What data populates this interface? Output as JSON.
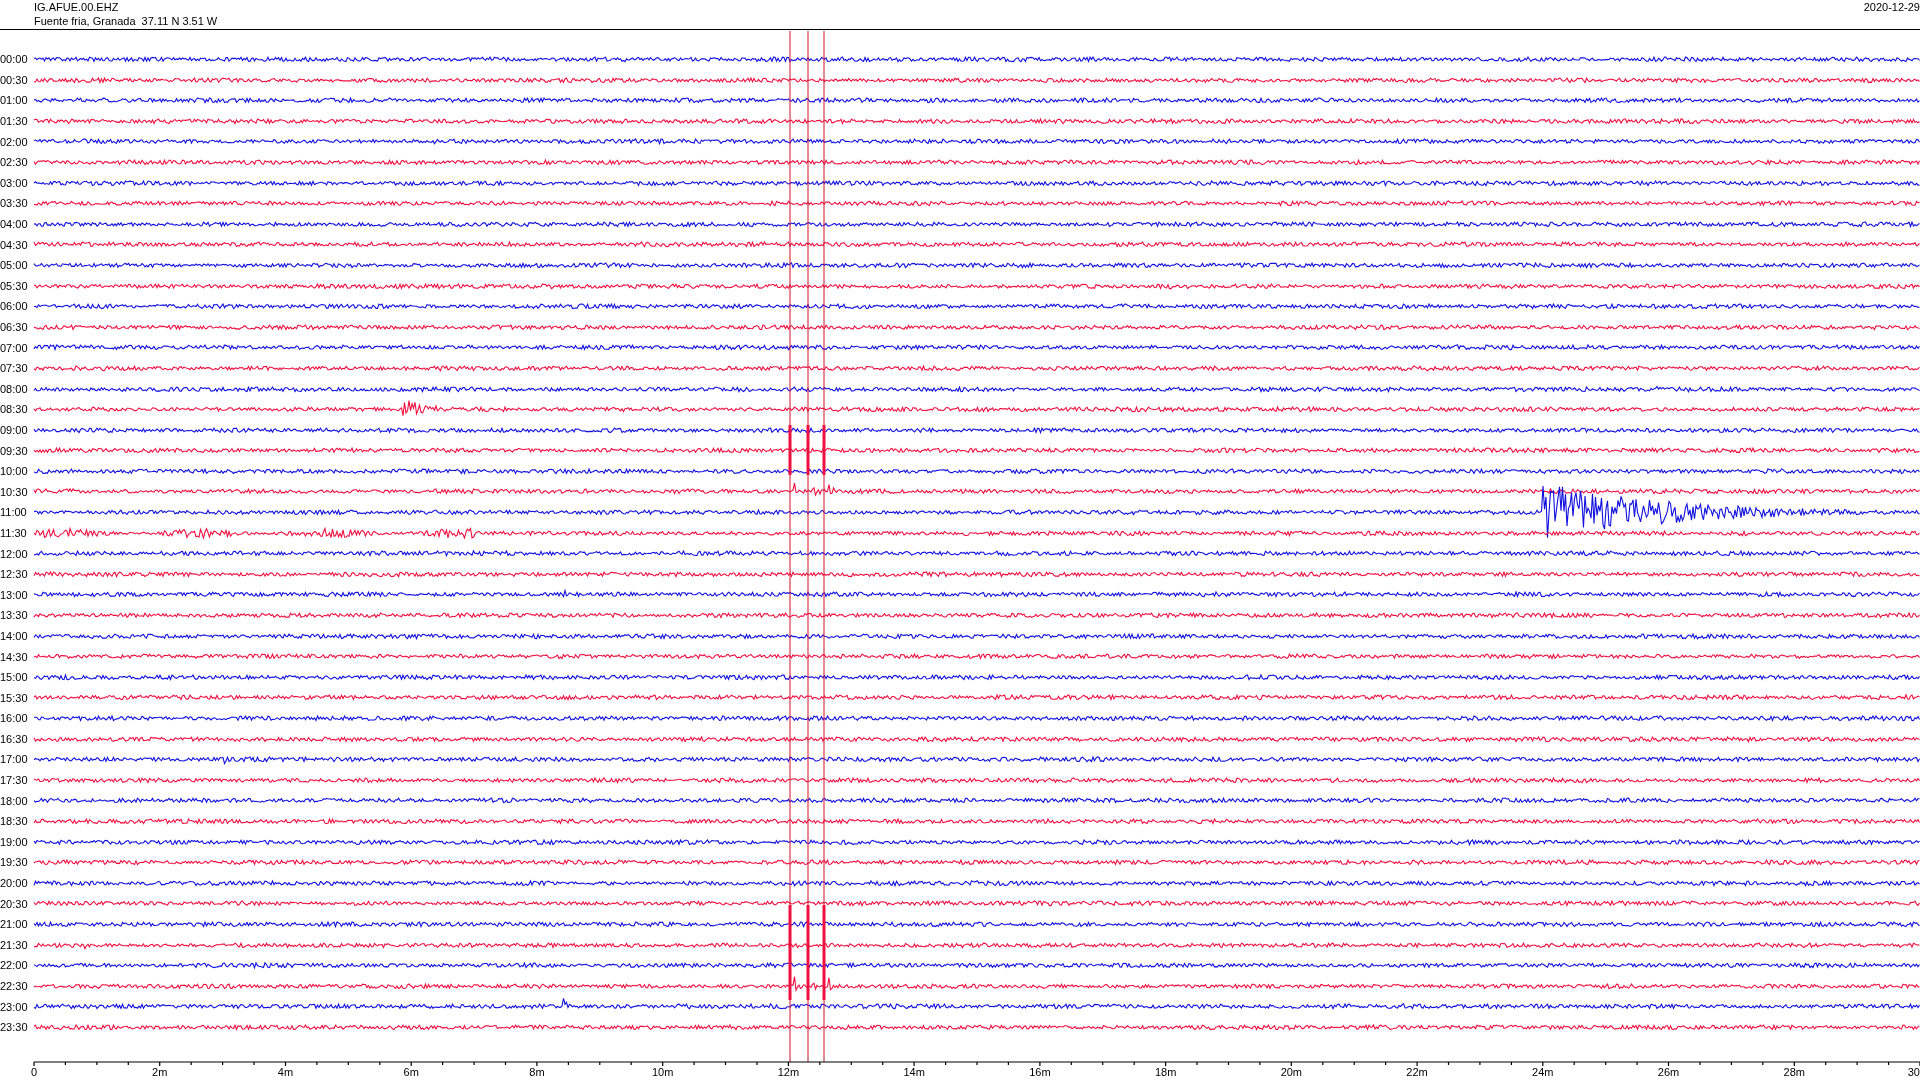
{
  "header": {
    "station": "IG.AFUE.00.EHZ",
    "location": "Fuente fria, Granada  37.11 N 3.51 W",
    "date": "2020-12-29"
  },
  "rows": [
    {
      "time": "00:00",
      "color": "#1010e0"
    },
    {
      "time": "00:30",
      "color": "#f01040"
    },
    {
      "time": "01:00",
      "color": "#1010e0"
    },
    {
      "time": "01:30",
      "color": "#f01040"
    },
    {
      "time": "02:00",
      "color": "#1010e0"
    },
    {
      "time": "02:30",
      "color": "#f01040"
    },
    {
      "time": "03:00",
      "color": "#1010e0"
    },
    {
      "time": "03:30",
      "color": "#f01040"
    },
    {
      "time": "04:00",
      "color": "#1010e0"
    },
    {
      "time": "04:30",
      "color": "#f01040"
    },
    {
      "time": "05:00",
      "color": "#1010e0"
    },
    {
      "time": "05:30",
      "color": "#f01040"
    },
    {
      "time": "06:00",
      "color": "#1010e0"
    },
    {
      "time": "06:30",
      "color": "#f01040"
    },
    {
      "time": "07:00",
      "color": "#1010e0"
    },
    {
      "time": "07:30",
      "color": "#f01040"
    },
    {
      "time": "08:00",
      "color": "#1010e0"
    },
    {
      "time": "08:30",
      "color": "#f01040"
    },
    {
      "time": "09:00",
      "color": "#1010e0"
    },
    {
      "time": "09:30",
      "color": "#f01040"
    },
    {
      "time": "10:00",
      "color": "#1010e0"
    },
    {
      "time": "10:30",
      "color": "#f01040"
    },
    {
      "time": "11:00",
      "color": "#1010e0"
    },
    {
      "time": "11:30",
      "color": "#f01040"
    },
    {
      "time": "12:00",
      "color": "#1010e0"
    },
    {
      "time": "12:30",
      "color": "#f01040"
    },
    {
      "time": "13:00",
      "color": "#1010e0"
    },
    {
      "time": "13:30",
      "color": "#f01040"
    },
    {
      "time": "14:00",
      "color": "#1010e0"
    },
    {
      "time": "14:30",
      "color": "#f01040"
    },
    {
      "time": "15:00",
      "color": "#1010e0"
    },
    {
      "time": "15:30",
      "color": "#f01040"
    },
    {
      "time": "16:00",
      "color": "#1010e0"
    },
    {
      "time": "16:30",
      "color": "#f01040"
    },
    {
      "time": "17:00",
      "color": "#1010e0"
    },
    {
      "time": "17:30",
      "color": "#f01040"
    },
    {
      "time": "18:00",
      "color": "#1010e0"
    },
    {
      "time": "18:30",
      "color": "#f01040"
    },
    {
      "time": "19:00",
      "color": "#1010e0"
    },
    {
      "time": "19:30",
      "color": "#f01040"
    },
    {
      "time": "20:00",
      "color": "#1010e0"
    },
    {
      "time": "20:30",
      "color": "#f01040"
    },
    {
      "time": "21:00",
      "color": "#1010e0"
    },
    {
      "time": "21:30",
      "color": "#f01040"
    },
    {
      "time": "22:00",
      "color": "#1010e0"
    },
    {
      "time": "22:30",
      "color": "#f01040"
    },
    {
      "time": "23:00",
      "color": "#1010e0"
    },
    {
      "time": "23:30",
      "color": "#f01040"
    }
  ],
  "axis_labels": [
    "0",
    "2m",
    "4m",
    "6m",
    "8m",
    "10m",
    "12m",
    "14m",
    "16m",
    "18m",
    "20m",
    "22m",
    "24m",
    "26m",
    "28m",
    "30"
  ]
}
